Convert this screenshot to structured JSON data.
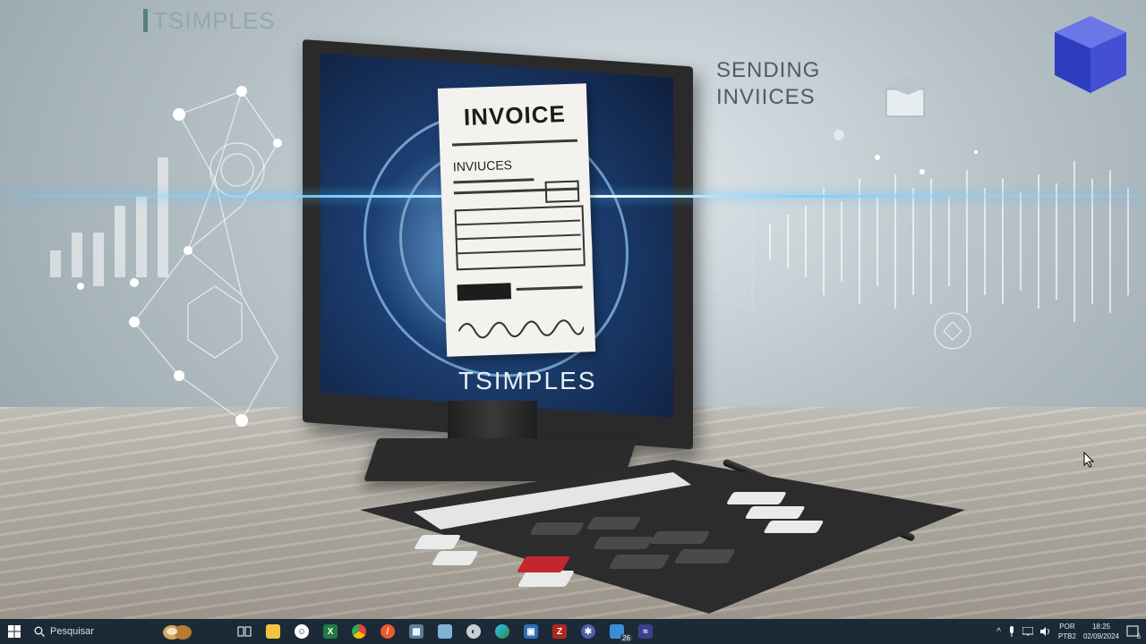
{
  "wallpaper": {
    "watermark_logo": "TSIMPLES",
    "headline_line1": "SENDING",
    "headline_line2": "INVIICES",
    "invoice_title": "INVOICE",
    "invoice_subtitle": "INVIUCES",
    "screen_brand": "TSIMPLES",
    "colors": {
      "accent_beam": "#7fd1ff",
      "screen": "#1c3f72",
      "calc_red_key": "#c2272d"
    }
  },
  "taskbar": {
    "start_icon": "windows-icon",
    "search_placeholder": "Pesquisar",
    "pinned_apps": [
      {
        "name": "weather-widget",
        "icon": "coconut-icon"
      },
      {
        "name": "task-view",
        "icon": "task-view-icon"
      },
      {
        "name": "file-explorer",
        "icon": "folder-icon"
      },
      {
        "name": "emoji-app",
        "icon": "smiley-icon"
      },
      {
        "name": "excel",
        "icon": "excel-icon"
      },
      {
        "name": "chrome",
        "icon": "chrome-icon"
      },
      {
        "name": "brave-browser",
        "icon": "brave-icon"
      },
      {
        "name": "calculator",
        "icon": "calculator-icon"
      },
      {
        "name": "notes-app",
        "icon": "note-icon"
      },
      {
        "name": "paint-app",
        "icon": "palette-icon"
      },
      {
        "name": "edge",
        "icon": "edge-icon"
      },
      {
        "name": "remote-desktop",
        "icon": "remote-icon"
      },
      {
        "name": "filezilla",
        "icon": "filezilla-icon"
      },
      {
        "name": "settings-app",
        "icon": "gear-icon"
      },
      {
        "name": "terminal-app",
        "icon": "terminal-icon",
        "badge": "26"
      },
      {
        "name": "vs-app",
        "icon": "visual-studio-icon"
      }
    ],
    "tray": {
      "language_line1": "POR",
      "language_line2": "PTB2",
      "time": "18:25",
      "date": "02/09/2024",
      "notification_count": "6"
    }
  }
}
